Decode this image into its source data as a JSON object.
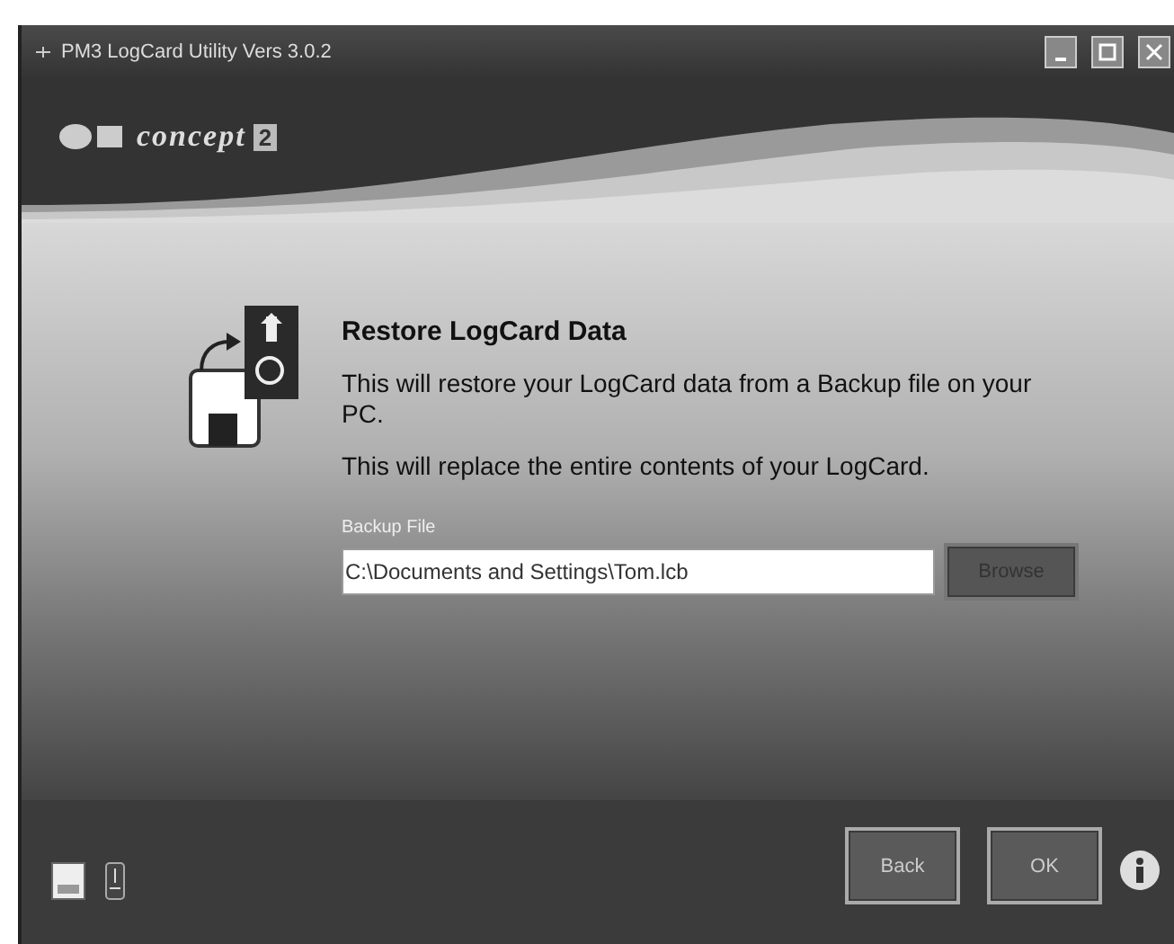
{
  "window": {
    "title": "PM3 LogCard Utility Vers 3.0.2"
  },
  "logo": {
    "name": "concept",
    "mark": "2"
  },
  "dialog": {
    "heading": "Restore LogCard Data",
    "paragraphs": [
      "This will restore your LogCard data from a Backup file on your PC.",
      "This will replace the entire contents of your LogCard."
    ],
    "field": {
      "label": "Backup File",
      "value": "C:\\Documents and Settings\\Tom.lcb"
    },
    "browse": "Browse"
  },
  "footer": {
    "buttons": [
      "Back",
      "OK"
    ]
  }
}
